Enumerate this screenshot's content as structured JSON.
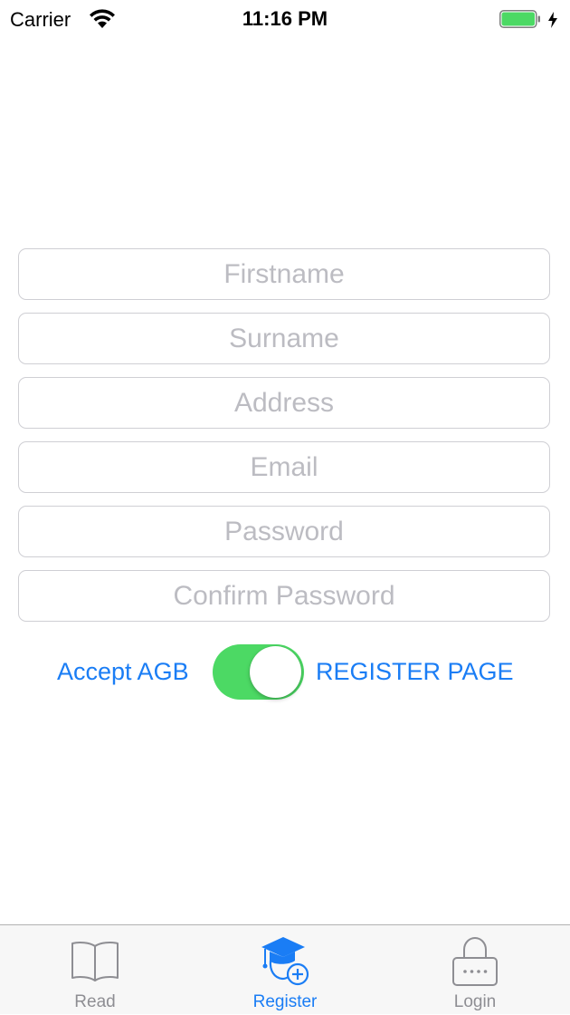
{
  "status_bar": {
    "carrier": "Carrier",
    "time": "11:16 PM",
    "battery_color": "#4cd964"
  },
  "form": {
    "fields": [
      {
        "placeholder": "Firstname",
        "value": ""
      },
      {
        "placeholder": "Surname",
        "value": ""
      },
      {
        "placeholder": "Address",
        "value": ""
      },
      {
        "placeholder": "Email",
        "value": ""
      },
      {
        "placeholder": "Password",
        "value": ""
      },
      {
        "placeholder": "Confirm Password",
        "value": ""
      }
    ],
    "accept_label": "Accept AGB",
    "toggle_on": true,
    "page_label": "REGISTER PAGE"
  },
  "tab_bar": {
    "tabs": [
      {
        "label": "Read",
        "icon": "book-icon",
        "active": false
      },
      {
        "label": "Register",
        "icon": "graduation-cap-add-icon",
        "active": true
      },
      {
        "label": "Login",
        "icon": "lock-icon",
        "active": false
      }
    ]
  },
  "colors": {
    "accent": "#1a7df5",
    "toggle_on": "#4cd964",
    "inactive_tab": "#8e8e93",
    "placeholder": "#bcbcc2"
  }
}
